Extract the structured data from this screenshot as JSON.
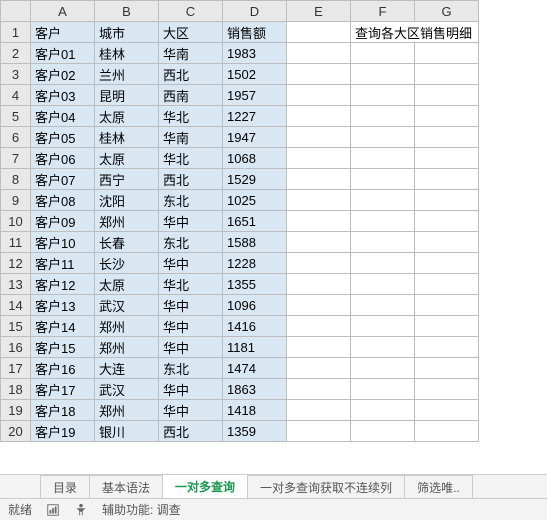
{
  "columns": [
    "A",
    "B",
    "C",
    "D",
    "E",
    "F",
    "G"
  ],
  "headers": {
    "A": "客户",
    "B": "城市",
    "C": "大区",
    "D": "销售额"
  },
  "note_text": "查询各大区销售明细",
  "rows": [
    {
      "n": 1,
      "a": "客户",
      "b": "城市",
      "c": "大区",
      "d": "销售额",
      "hdr": true
    },
    {
      "n": 2,
      "a": "客户01",
      "b": "桂林",
      "c": "华南",
      "d": 1983
    },
    {
      "n": 3,
      "a": "客户02",
      "b": "兰州",
      "c": "西北",
      "d": 1502
    },
    {
      "n": 4,
      "a": "客户03",
      "b": "昆明",
      "c": "西南",
      "d": 1957
    },
    {
      "n": 5,
      "a": "客户04",
      "b": "太原",
      "c": "华北",
      "d": 1227
    },
    {
      "n": 6,
      "a": "客户05",
      "b": "桂林",
      "c": "华南",
      "d": 1947
    },
    {
      "n": 7,
      "a": "客户06",
      "b": "太原",
      "c": "华北",
      "d": 1068
    },
    {
      "n": 8,
      "a": "客户07",
      "b": "西宁",
      "c": "西北",
      "d": 1529
    },
    {
      "n": 9,
      "a": "客户08",
      "b": "沈阳",
      "c": "东北",
      "d": 1025
    },
    {
      "n": 10,
      "a": "客户09",
      "b": "郑州",
      "c": "华中",
      "d": 1651
    },
    {
      "n": 11,
      "a": "客户10",
      "b": "长春",
      "c": "东北",
      "d": 1588
    },
    {
      "n": 12,
      "a": "客户11",
      "b": "长沙",
      "c": "华中",
      "d": 1228
    },
    {
      "n": 13,
      "a": "客户12",
      "b": "太原",
      "c": "华北",
      "d": 1355
    },
    {
      "n": 14,
      "a": "客户13",
      "b": "武汉",
      "c": "华中",
      "d": 1096
    },
    {
      "n": 15,
      "a": "客户14",
      "b": "郑州",
      "c": "华中",
      "d": 1416
    },
    {
      "n": 16,
      "a": "客户15",
      "b": "郑州",
      "c": "华中",
      "d": 1181
    },
    {
      "n": 17,
      "a": "客户16",
      "b": "大连",
      "c": "东北",
      "d": 1474
    },
    {
      "n": 18,
      "a": "客户17",
      "b": "武汉",
      "c": "华中",
      "d": 1863
    },
    {
      "n": 19,
      "a": "客户18",
      "b": "郑州",
      "c": "华中",
      "d": 1418
    },
    {
      "n": 20,
      "a": "客户19",
      "b": "银川",
      "c": "西北",
      "d": 1359
    }
  ],
  "tabs": [
    {
      "label": "目录",
      "active": false
    },
    {
      "label": "基本语法",
      "active": false
    },
    {
      "label": "一对多查询",
      "active": true
    },
    {
      "label": "一对多查询获取不连续列",
      "active": false
    },
    {
      "label": "筛选唯..",
      "active": false
    }
  ],
  "status": {
    "ready": "就绪",
    "assist": "辅助功能: 调查"
  }
}
